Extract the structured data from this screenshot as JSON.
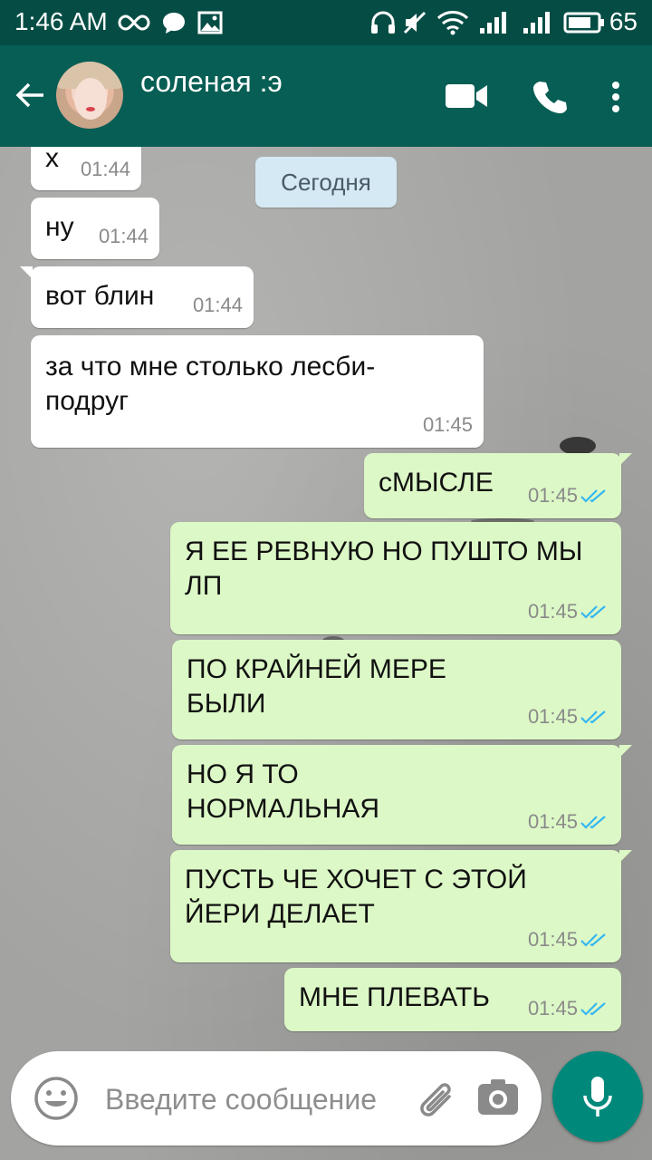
{
  "status_bar": {
    "time": "1:46 AM",
    "battery": "65",
    "icons": [
      "infinity-icon",
      "chat-bubble-icon",
      "image-icon",
      "headphones-icon",
      "mute-icon",
      "wifi-icon",
      "signal-icon",
      "signal-icon",
      "battery-icon"
    ]
  },
  "header": {
    "contact_name": "соленая :э",
    "icons": [
      "back-arrow-icon",
      "avatar",
      "video-call-icon",
      "phone-icon",
      "more-vertical-icon"
    ]
  },
  "date_chip": "Сегодня",
  "messages": [
    {
      "direction": "in",
      "text": "х",
      "time": "01:44"
    },
    {
      "direction": "in",
      "text": "ну",
      "time": "01:44"
    },
    {
      "direction": "in",
      "text": "вот блин",
      "time": "01:44"
    },
    {
      "direction": "in",
      "text": "за что мне столько лесби-\nподруг",
      "time": "01:45"
    },
    {
      "direction": "out",
      "text": "сМЫСЛЕ",
      "time": "01:45",
      "status": "read"
    },
    {
      "direction": "out",
      "text": "Я ЕЕ РЕВНУЮ НО ПУШТО МЫ\nЛП",
      "time": "01:45",
      "status": "read"
    },
    {
      "direction": "out",
      "text": "ПО КРАЙНЕЙ МЕРЕ\nБЫЛИ",
      "time": "01:45",
      "status": "read"
    },
    {
      "direction": "out",
      "text": "НО Я ТО\nНОРМАЛЬНАЯ",
      "time": "01:45",
      "status": "read"
    },
    {
      "direction": "out",
      "text": "ПУСТЬ ЧЕ ХОЧЕТ С ЭТОЙ\nЙЕРИ ДЕЛАЕТ",
      "time": "01:45",
      "status": "read"
    },
    {
      "direction": "out",
      "text": "МНЕ ПЛЕВАТЬ",
      "time": "01:45",
      "status": "read"
    }
  ],
  "input": {
    "placeholder": "Введите сообщение",
    "value": ""
  },
  "colors": {
    "header": "#075e54",
    "status_bar": "#054d44",
    "incoming_bubble": "#ffffff",
    "outgoing_bubble": "#dcf8c6",
    "read_ticks": "#34b7f1",
    "mic_button": "#00897b",
    "date_chip": "#d4e9f3"
  }
}
